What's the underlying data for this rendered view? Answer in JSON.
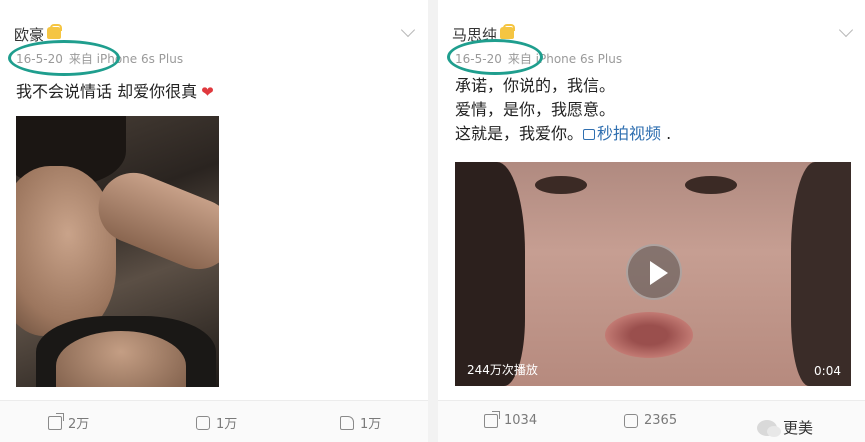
{
  "left_post": {
    "author": "欧豪",
    "date": "16-5-20",
    "source": "来自 iPhone 6s Plus",
    "text": "我不会说情话  却爱你很真",
    "actions": {
      "share": "2万",
      "comment": "1万",
      "like": "1万"
    }
  },
  "right_post": {
    "author": "马思纯",
    "date": "16-5-20",
    "source": "来自 iPhone 6s Plus",
    "text_lines": [
      "承诺，你说的，我信。",
      "爱情，是你，我愿意。",
      "这就是，我爱你。"
    ],
    "video_link": "秒拍视频",
    "trailing": " .",
    "video": {
      "views": "244万次播放",
      "duration": "0:04"
    },
    "actions": {
      "share": "1034",
      "comment": "2365"
    }
  },
  "watermark": {
    "label": "更美"
  },
  "colors": {
    "highlight": "#1f9e8e",
    "link": "#2f6fb0",
    "heart": "#e0393e"
  },
  "icons": [
    "vip-icon",
    "chevron-down-icon",
    "heart-icon",
    "camera-icon",
    "play-icon",
    "share-icon",
    "comment-icon",
    "like-icon",
    "wechat-icon"
  ]
}
